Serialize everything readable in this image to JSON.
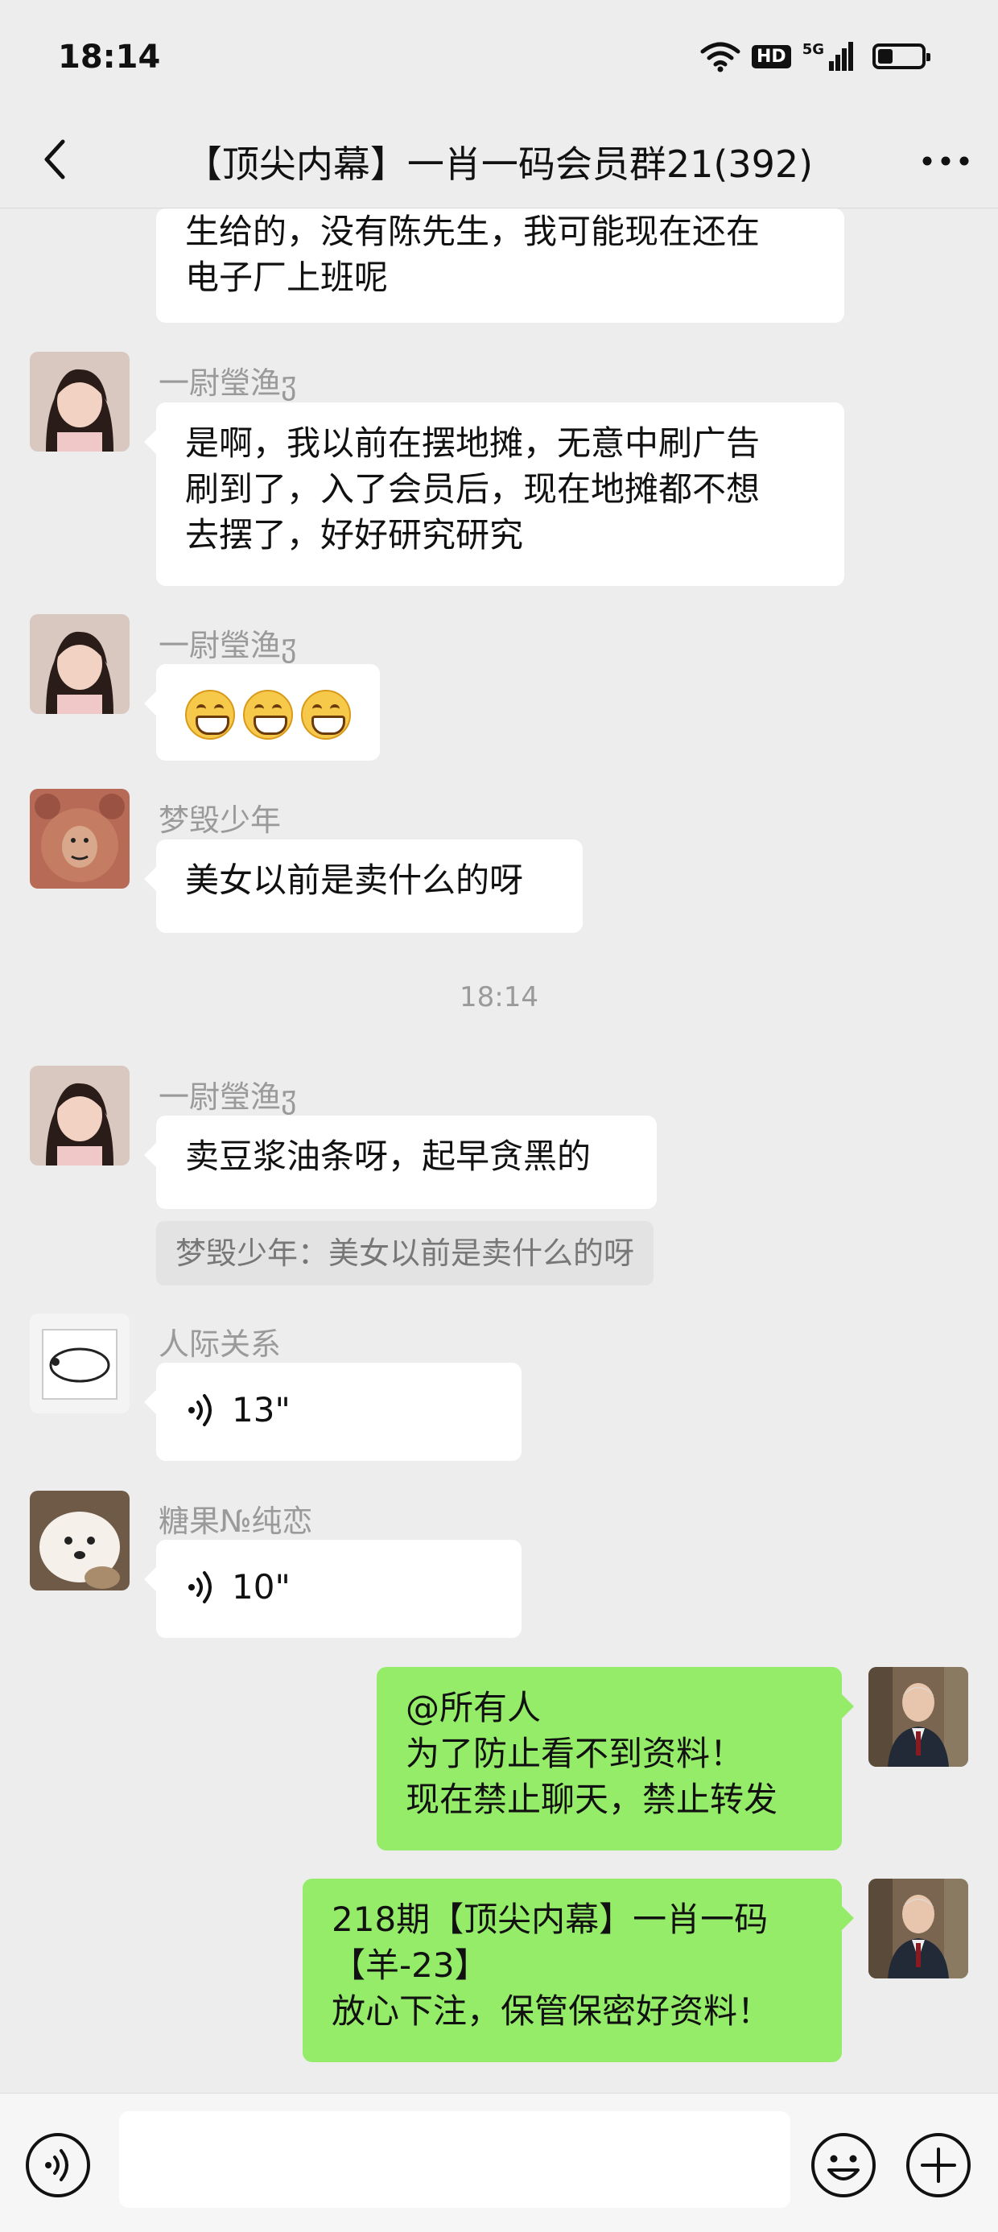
{
  "status_bar": {
    "time": "18:14",
    "hd": "HD",
    "network": "5G"
  },
  "header": {
    "title": "【顶尖内幕】一肖一码会员群21(392)"
  },
  "messages": {
    "m0": {
      "lines": [
        "生给的，没有陈先生，我可能现在还在",
        "电子厂上班呢"
      ]
    },
    "m1": {
      "sender": "一尉瑩渔ჳ",
      "lines": [
        "是啊，我以前在摆地摊，无意中刷广告",
        "刷到了，入了会员后，现在地摊都不想",
        "去摆了，好好研究研究"
      ]
    },
    "m2": {
      "sender": "一尉瑩渔ჳ",
      "emoji": "grinning-face x3"
    },
    "m3": {
      "sender": "梦毁少年",
      "text": "美女以前是卖什么的呀"
    },
    "timestamp": "18:14",
    "m4": {
      "sender": "一尉瑩渔ჳ",
      "text": "卖豆浆油条呀，起早贪黑的",
      "quote": "梦毁少年：美女以前是卖什么的呀"
    },
    "m5": {
      "sender": "人际关系",
      "duration": "13\""
    },
    "m6": {
      "sender": "糖果№纯恋",
      "duration": "10\""
    },
    "m7": {
      "lines": [
        "@所有人",
        "为了防止看不到资料！",
        "现在禁止聊天，禁止转发"
      ]
    },
    "m8": {
      "lines": [
        "218期【顶尖内幕】一肖一码",
        "【羊-23】",
        "放心下注，保管保密好资料！"
      ]
    }
  },
  "input_bar": {
    "placeholder": ""
  },
  "colors": {
    "self_bubble": "#95ec69",
    "other_bubble": "#ffffff",
    "background": "#ededed"
  }
}
